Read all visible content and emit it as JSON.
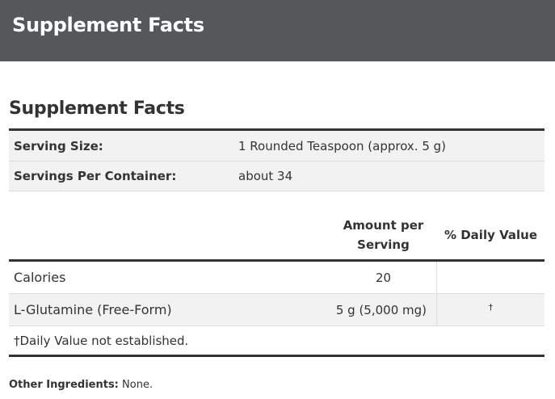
{
  "header": {
    "title": "Supplement Facts"
  },
  "panel": {
    "title": "Supplement Facts",
    "serving_size_label": "Serving Size:",
    "serving_size_value": "1 Rounded Teaspoon (approx. 5 g)",
    "servings_label": "Servings Per Container:",
    "servings_value": "about 34",
    "col_amount_line1": "Amount per",
    "col_amount_line2": "Serving",
    "col_daily_value": "% Daily Value",
    "rows": [
      {
        "name": "Calories",
        "amount": "20",
        "dv": ""
      },
      {
        "name": "L-Glutamine (Free-Form)",
        "amount": "5 g (5,000 mg)",
        "dv": "†"
      }
    ],
    "footnote": "†Daily Value not established."
  },
  "other_ingredients": {
    "label": "Other Ingredients:",
    "value": "None."
  }
}
